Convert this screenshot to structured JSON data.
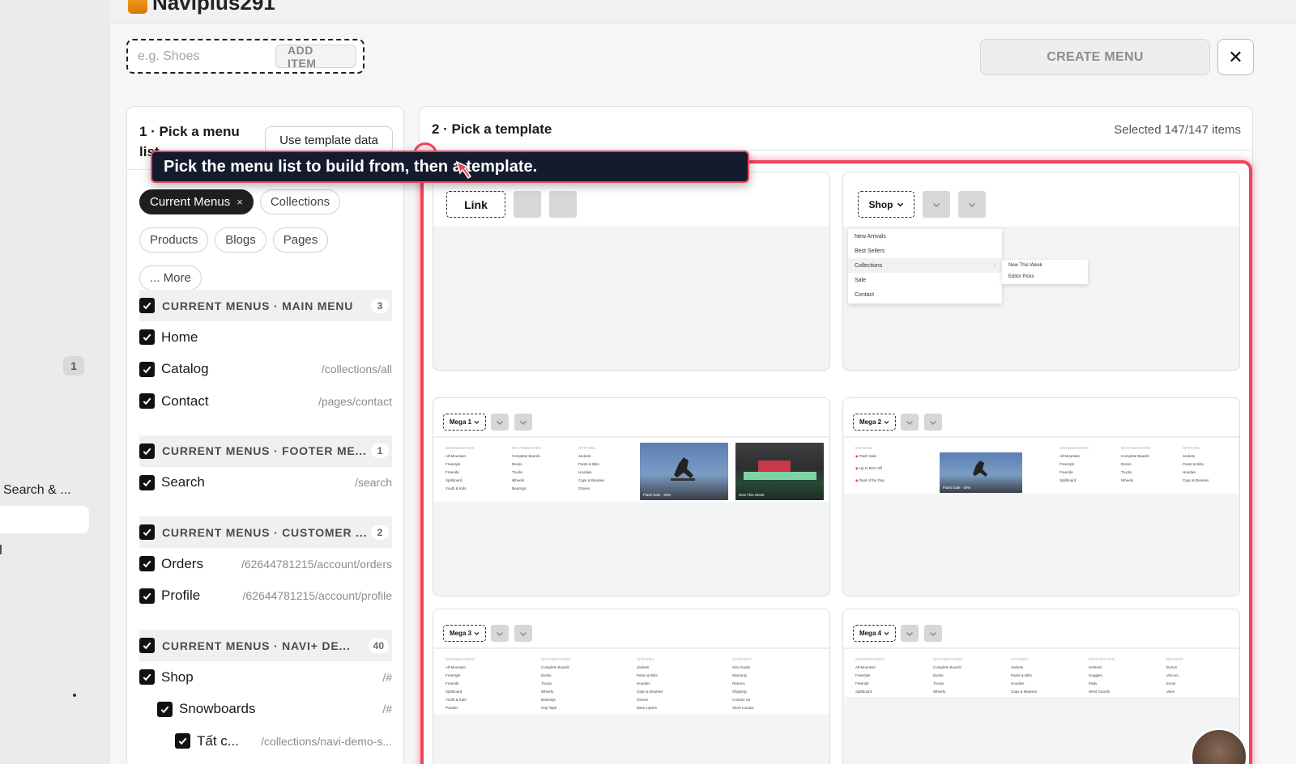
{
  "header": {
    "title": "Naviplus291"
  },
  "strip": {
    "badge": "1",
    "search_label": "Search & ..."
  },
  "add_item": {
    "placeholder": "e.g. Shoes",
    "button": "ADD ITEM"
  },
  "create_menu": "CREATE MENU",
  "close_label": "✕",
  "left_panel": {
    "title": "1 · Pick a menu list",
    "use_template": "Use template data",
    "chips": [
      {
        "label": "Current Menus",
        "active": true,
        "close": "×"
      },
      {
        "label": "Collections"
      },
      {
        "label": "Products"
      },
      {
        "label": "Blogs"
      },
      {
        "label": "Pages"
      },
      {
        "label": "... More"
      }
    ],
    "groups": [
      {
        "name": "CURRENT MENUS · MAIN MENU",
        "count": "3",
        "items": [
          {
            "label": "Home",
            "path": ""
          },
          {
            "label": "Catalog",
            "path": "/collections/all"
          },
          {
            "label": "Contact",
            "path": "/pages/contact"
          }
        ]
      },
      {
        "name": "CURRENT MENUS · FOOTER ME...",
        "count": "1",
        "items": [
          {
            "label": "Search",
            "path": "/search"
          }
        ]
      },
      {
        "name": "CURRENT MENUS · CUSTOMER ...",
        "count": "2",
        "items": [
          {
            "label": "Orders",
            "path": "/62644781215/account/orders"
          },
          {
            "label": "Profile",
            "path": "/62644781215/account/profile"
          }
        ]
      },
      {
        "name": "CURRENT MENUS · NAVI+ DE...",
        "count": "40",
        "items": [
          {
            "label": "Shop",
            "path": "/#"
          },
          {
            "label": "Snowboards",
            "path": "/#"
          },
          {
            "label": "Tất c...",
            "path": "/collections/navi-demo-s..."
          }
        ]
      }
    ]
  },
  "right_panel": {
    "title": "2 · Pick a template",
    "selected": "Selected 147/147 items",
    "templates": {
      "link": {
        "trigger": "Link"
      },
      "shop": {
        "trigger": "Shop",
        "items": [
          "New Arrivals",
          "Best Sellers",
          "Collections",
          "Sale",
          "Contact"
        ],
        "sub_items": [
          "New This Week",
          "Editor Picks"
        ]
      },
      "mega1": {
        "trigger": "Mega 1",
        "cols": [
          {
            "h": "SNOWBOARDS",
            "items": [
              "All-Mountain",
              "Freestyle",
              "Freeride",
              "Splitboard",
              "Youth & Kids"
            ]
          },
          {
            "h": "SKATEBOARDS",
            "items": [
              "Complete Boards",
              "Decks",
              "Trucks",
              "Wheels",
              "Bearings"
            ]
          },
          {
            "h": "APPAREL",
            "items": [
              "Jackets",
              "Pants & Bibs",
              "Hoodies",
              "Caps & Beanies",
              "Gloves"
            ]
          }
        ],
        "img1_cap": "Flash Sale - 40%",
        "img2_cap": "New This Week"
      },
      "mega2": {
        "trigger": "Mega 2",
        "deals_head": "ON NOW",
        "deals": [
          "Flash Sale",
          "Up to 50% Off",
          "Deal of the Day"
        ],
        "img_cap": "Flash Sale - 40%",
        "cols": [
          {
            "h": "SNOWBOARDS",
            "items": [
              "All-Mountain",
              "Freestyle",
              "Freeride",
              "Splitboard"
            ]
          },
          {
            "h": "SKATEBOARDS",
            "items": [
              "Complete Boards",
              "Decks",
              "Trucks",
              "Wheels"
            ]
          },
          {
            "h": "APPAREL",
            "items": [
              "Jackets",
              "Pants & Bibs",
              "Hoodies",
              "Caps & Beanies"
            ]
          }
        ]
      },
      "mega3": {
        "trigger": "Mega 3",
        "cols": [
          {
            "h": "SNOWBOARDS",
            "items": [
              "All-Mountain",
              "Freestyle",
              "Freeride",
              "Splitboard",
              "Youth & Kids",
              "Powder"
            ]
          },
          {
            "h": "SKATEBOARDS",
            "items": [
              "Complete Boards",
              "Decks",
              "Trucks",
              "Wheels",
              "Bearings",
              "Grip Tape"
            ]
          },
          {
            "h": "APPAREL",
            "items": [
              "Jackets",
              "Pants & Bibs",
              "Hoodies",
              "Caps & Beanies",
              "Gloves",
              "Base Layers"
            ]
          },
          {
            "h": "SUPPORT",
            "items": [
              "Size Guide",
              "Warranty",
              "Returns",
              "Shipping",
              "Contact Us",
              "Store Locator"
            ]
          }
        ]
      },
      "mega4": {
        "trigger": "Mega 4",
        "cols": [
          {
            "h": "SNOWBOARDS",
            "items": [
              "All-Mountain",
              "Freestyle",
              "Freeride",
              "Splitboard"
            ]
          },
          {
            "h": "SKATEBOARDS",
            "items": [
              "Complete Boards",
              "Decks",
              "Trucks",
              "Wheels"
            ]
          },
          {
            "h": "APPAREL",
            "items": [
              "Jackets",
              "Pants & Bibs",
              "Hoodies",
              "Caps & Beanies"
            ]
          },
          {
            "h": "PROTECTION",
            "items": [
              "Helmets",
              "Goggles",
              "Pads",
              "Wrist Guards"
            ]
          },
          {
            "h": "BRANDS",
            "items": [
              "Burton",
              "Volcom",
              "Ennis",
              "Vans"
            ]
          }
        ]
      }
    }
  },
  "tooltip": {
    "text": "Pick the menu list to build from, then a template."
  },
  "colors": {
    "accent": "#f0445a",
    "tooltip_bg": "#141b2d",
    "checkbox": "#111111"
  },
  "icons": [
    "close-icon",
    "check-icon",
    "chevron-down-icon",
    "chevron-right-icon",
    "cursor-icon"
  ]
}
